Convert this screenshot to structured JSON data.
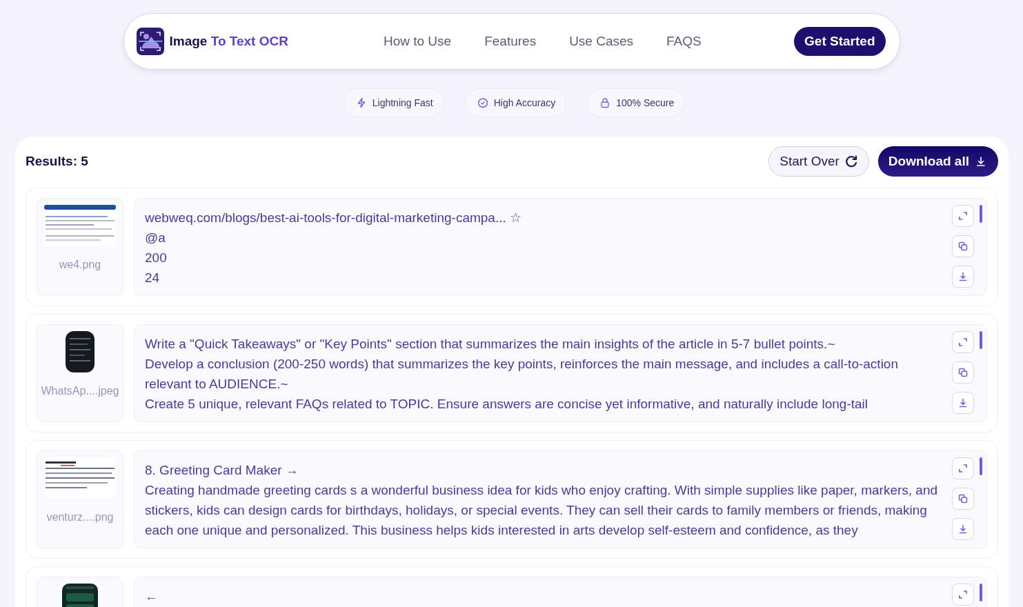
{
  "nav": {
    "brand": {
      "first": "Image",
      "accent": "To Text OCR"
    },
    "links": [
      "How to Use",
      "Features",
      "Use Cases",
      "FAQS"
    ],
    "cta": "Get Started"
  },
  "badges": [
    {
      "kind": "bolt",
      "label": "Lightning Fast"
    },
    {
      "kind": "badge",
      "label": "High Accuracy"
    },
    {
      "kind": "lock",
      "label": "100% Secure"
    }
  ],
  "results": {
    "title": "Results: 5",
    "start_over": "Start Over",
    "download_all": "Download all",
    "items": [
      {
        "filename": "we4.png",
        "thumbnail": {
          "kind": "picture"
        },
        "actions": [
          {
            "kind": "expand"
          },
          {
            "kind": "copy"
          },
          {
            "kind": "download"
          }
        ],
        "lines": [
          "webweq.com/blogs/best-ai-tools-for-digital-marketing-campa... ☆",
          "@a",
          "200",
          "24"
        ]
      },
      {
        "filename": "WhatsAp....jpeg",
        "thumbnail": {
          "kind": "picture"
        },
        "actions": [
          {
            "kind": "expand"
          },
          {
            "kind": "copy"
          },
          {
            "kind": "download"
          }
        ],
        "lines": [
          "Write a \"Quick Takeaways\" or \"Key Points\" section that summarizes the main insights of the article in 5-7 bullet points.~",
          "Develop a conclusion (200-250 words) that summarizes the key points, reinforces the main message, and includes a call-to-action relevant to AUDIENCE.~",
          "Create 5 unique, relevant FAQs related to TOPIC. Ensure answers are concise yet informative, and naturally include long-tail"
        ]
      },
      {
        "filename": "venturz....png",
        "thumbnail": {
          "kind": "picture"
        },
        "actions": [
          {
            "kind": "expand"
          },
          {
            "kind": "copy"
          },
          {
            "kind": "download"
          }
        ],
        "lines": [
          "8. Greeting Card Maker →",
          "Creating handmade greeting cards s a wonderful business idea for kids who enjoy crafting. With simple supplies like paper, markers, and stickers, kids can design cards for birthdays, holidays, or special events. They can sell their cards to family members or friends, making each one unique and personalized. This business helps kids interested in arts develop self-esteem and confidence, as they"
        ]
      },
      {
        "thumbnail": {
          "kind": "picture"
        },
        "actions": [
          {
            "kind": "expand"
          }
        ],
        "lines": [
          "←"
        ]
      }
    ]
  }
}
